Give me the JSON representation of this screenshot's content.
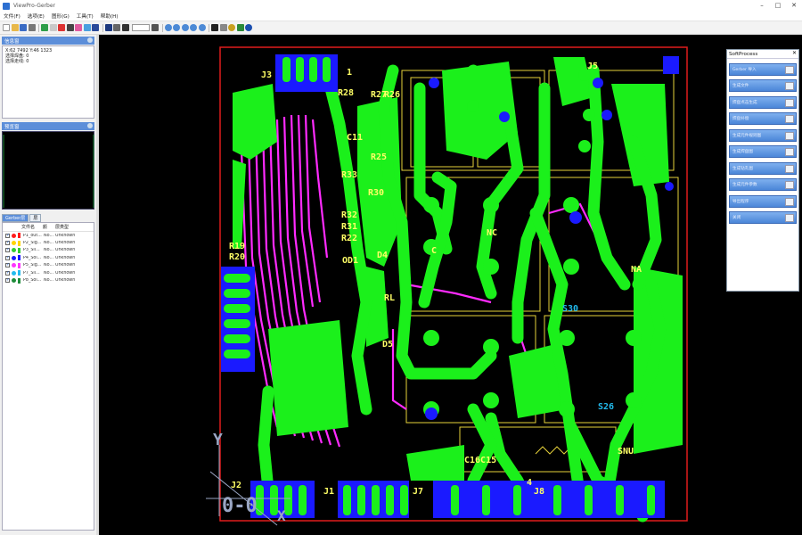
{
  "window": {
    "title": "ViewPro-Gerber",
    "controls": [
      "–",
      "□",
      "✕"
    ]
  },
  "menu": [
    "文件(F)",
    "选项(E)",
    "图形(G)",
    "工具(T)",
    "帮助(H)"
  ],
  "toolbar": {
    "zoom_value": ""
  },
  "panels": {
    "info_title": "信息窗",
    "info_lines": [
      "X:62 7492  Y:46 1323",
      "选择焊盘: 0",
      "选择走线: 0"
    ],
    "preview_title": "预览窗",
    "tab_active": "Gerber层",
    "tab_other": "层"
  },
  "layers": {
    "headers": [
      "文件名",
      "颜",
      "层类型"
    ],
    "rows": [
      {
        "name": "P1_out...",
        "kind": "No...",
        "type": "Unknown",
        "color": "#ff1a1a"
      },
      {
        "name": "P2_Sig...",
        "kind": "No...",
        "type": "Unknown",
        "color": "#ffd400"
      },
      {
        "name": "P3_Sil...",
        "kind": "No...",
        "type": "Unknown",
        "color": "#33cc33"
      },
      {
        "name": "P4_Sol...",
        "kind": "No...",
        "type": "Unknown",
        "color": "#1a1aff"
      },
      {
        "name": "P5_Sig...",
        "kind": "No...",
        "type": "Unknown",
        "color": "#ff33ff"
      },
      {
        "name": "P7_Sil...",
        "kind": "No...",
        "type": "Unknown",
        "color": "#22bbee"
      },
      {
        "name": "P8_Sol...",
        "kind": "No...",
        "type": "Unknown",
        "color": "#1e8c3a"
      }
    ]
  },
  "board": {
    "labels": [
      {
        "text": "J3",
        "color": "#ffff66"
      },
      {
        "text": "1",
        "color": "#ffff66"
      },
      {
        "text": "R28",
        "color": "#ffff66"
      },
      {
        "text": "R27",
        "color": "#ffff66"
      },
      {
        "text": "R26",
        "color": "#ffff66"
      },
      {
        "text": "J5",
        "color": "#ffff66"
      },
      {
        "text": "R25",
        "color": "#ffff66"
      },
      {
        "text": "R33",
        "color": "#ffff66"
      },
      {
        "text": "C11",
        "color": "#ffff66"
      },
      {
        "text": "R30",
        "color": "#ffff66"
      },
      {
        "text": "R32",
        "color": "#ffff66"
      },
      {
        "text": "R31",
        "color": "#ffff66"
      },
      {
        "text": "R22",
        "color": "#ffff66"
      },
      {
        "text": "R19",
        "color": "#ffff66"
      },
      {
        "text": "R20",
        "color": "#ffff66"
      },
      {
        "text": "OD1",
        "color": "#ffff66"
      },
      {
        "text": "D4",
        "color": "#ffff66"
      },
      {
        "text": "C",
        "color": "#ffff66"
      },
      {
        "text": "NC",
        "color": "#ffff66"
      },
      {
        "text": "NA",
        "color": "#ffff66"
      },
      {
        "text": "RL",
        "color": "#ffff66"
      },
      {
        "text": "D5",
        "color": "#ffff66"
      },
      {
        "text": "SNU",
        "color": "#ffff66"
      },
      {
        "text": "J2",
        "color": "#ffff66"
      },
      {
        "text": "J1",
        "color": "#ffff66"
      },
      {
        "text": "J7",
        "color": "#ffff66"
      },
      {
        "text": "J8",
        "color": "#ffff66"
      },
      {
        "text": "C16C15",
        "color": "#ffff66"
      },
      {
        "text": "4",
        "color": "#ffff66"
      },
      {
        "text": "S30",
        "color": "#22bbee"
      },
      {
        "text": "S26",
        "color": "#22bbee"
      },
      {
        "text": "0-0",
        "color": "#9aa6c4"
      },
      {
        "text": "Y",
        "color": "#9aa6c4"
      },
      {
        "text": "X",
        "color": "#9aa6c4"
      }
    ]
  },
  "softprocess": {
    "title": "SoftProcess",
    "buttons": [
      "Gerber 导入",
      "生成文件",
      "焊盘点击生成",
      "焊盘补偿",
      "生成元件规则图",
      "生成焊盘图",
      "生成钻孔图",
      "生成元件参数",
      "导出程序",
      "关闭"
    ]
  }
}
